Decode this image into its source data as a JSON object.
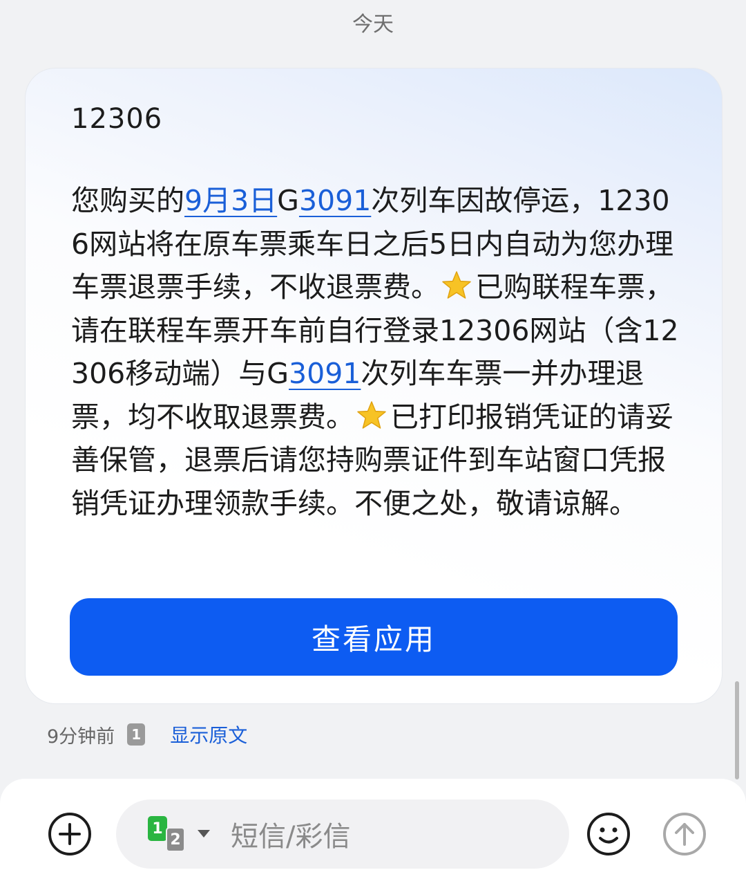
{
  "date_header": "今天",
  "message": {
    "sender": "12306",
    "segments": [
      {
        "text": "您购买的",
        "type": "text"
      },
      {
        "text": "9月3日",
        "type": "link"
      },
      {
        "text": "G",
        "type": "text"
      },
      {
        "text": "3091",
        "type": "link"
      },
      {
        "text": "次列车因故停运，12306网站将在原车票乘车日之后5日内自动为您办理车票退票手续，不收退票费。",
        "type": "text"
      },
      {
        "icon": "star-emoji-icon",
        "type": "emoji"
      },
      {
        "text": "已购联程车票，请在联程车票开车前自行登录12306网站（含12306移动端）与G",
        "type": "text"
      },
      {
        "text": "3091",
        "type": "link"
      },
      {
        "text": "次列车车票一并办理退票，均不收取退票费。",
        "type": "text"
      },
      {
        "icon": "star-emoji-icon",
        "type": "emoji"
      },
      {
        "text": "已打印报销凭证的请妥善保管，退票后请您持购票证件到车站窗口凭报销凭证办理领款手续。不便之处，敬请谅解。",
        "type": "text"
      }
    ],
    "action_button": "查看应用",
    "timestamp": "9分钟前",
    "sim_badge": "1",
    "show_original": "显示原文"
  },
  "compose": {
    "sim_primary": "1",
    "sim_secondary": "2",
    "placeholder": "短信/彩信"
  },
  "colors": {
    "link": "#1a5fd8",
    "button": "#0d5cf2",
    "sim1": "#2ab541",
    "sim2": "#8b8b8b",
    "star": "#f7c325"
  },
  "icons": {
    "add": "plus-circle-icon",
    "emoji": "smiley-icon",
    "send": "arrow-up-circle-icon",
    "dropdown": "caret-down-icon"
  }
}
